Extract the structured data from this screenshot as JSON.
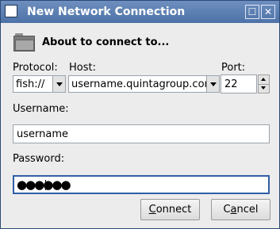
{
  "window": {
    "title": "New Network Connection",
    "maximize_glyph": "☐",
    "close_glyph": "✕"
  },
  "header": {
    "heading": "About to connect to...",
    "icon": "folder-icon"
  },
  "protocol": {
    "label": "Protocol:",
    "value": "fish://"
  },
  "host": {
    "label": "Host:",
    "value": "username.quintagroup.con"
  },
  "port": {
    "label": "Port:",
    "value": "22"
  },
  "username": {
    "label": "Username:",
    "value": "username"
  },
  "password": {
    "label": "Password:",
    "value": "●●●●●●"
  },
  "buttons": {
    "connect_mnemonic": "C",
    "connect_rest": "onnect",
    "cancel_pre": "C",
    "cancel_mnemonic": "a",
    "cancel_rest": "ncel"
  }
}
